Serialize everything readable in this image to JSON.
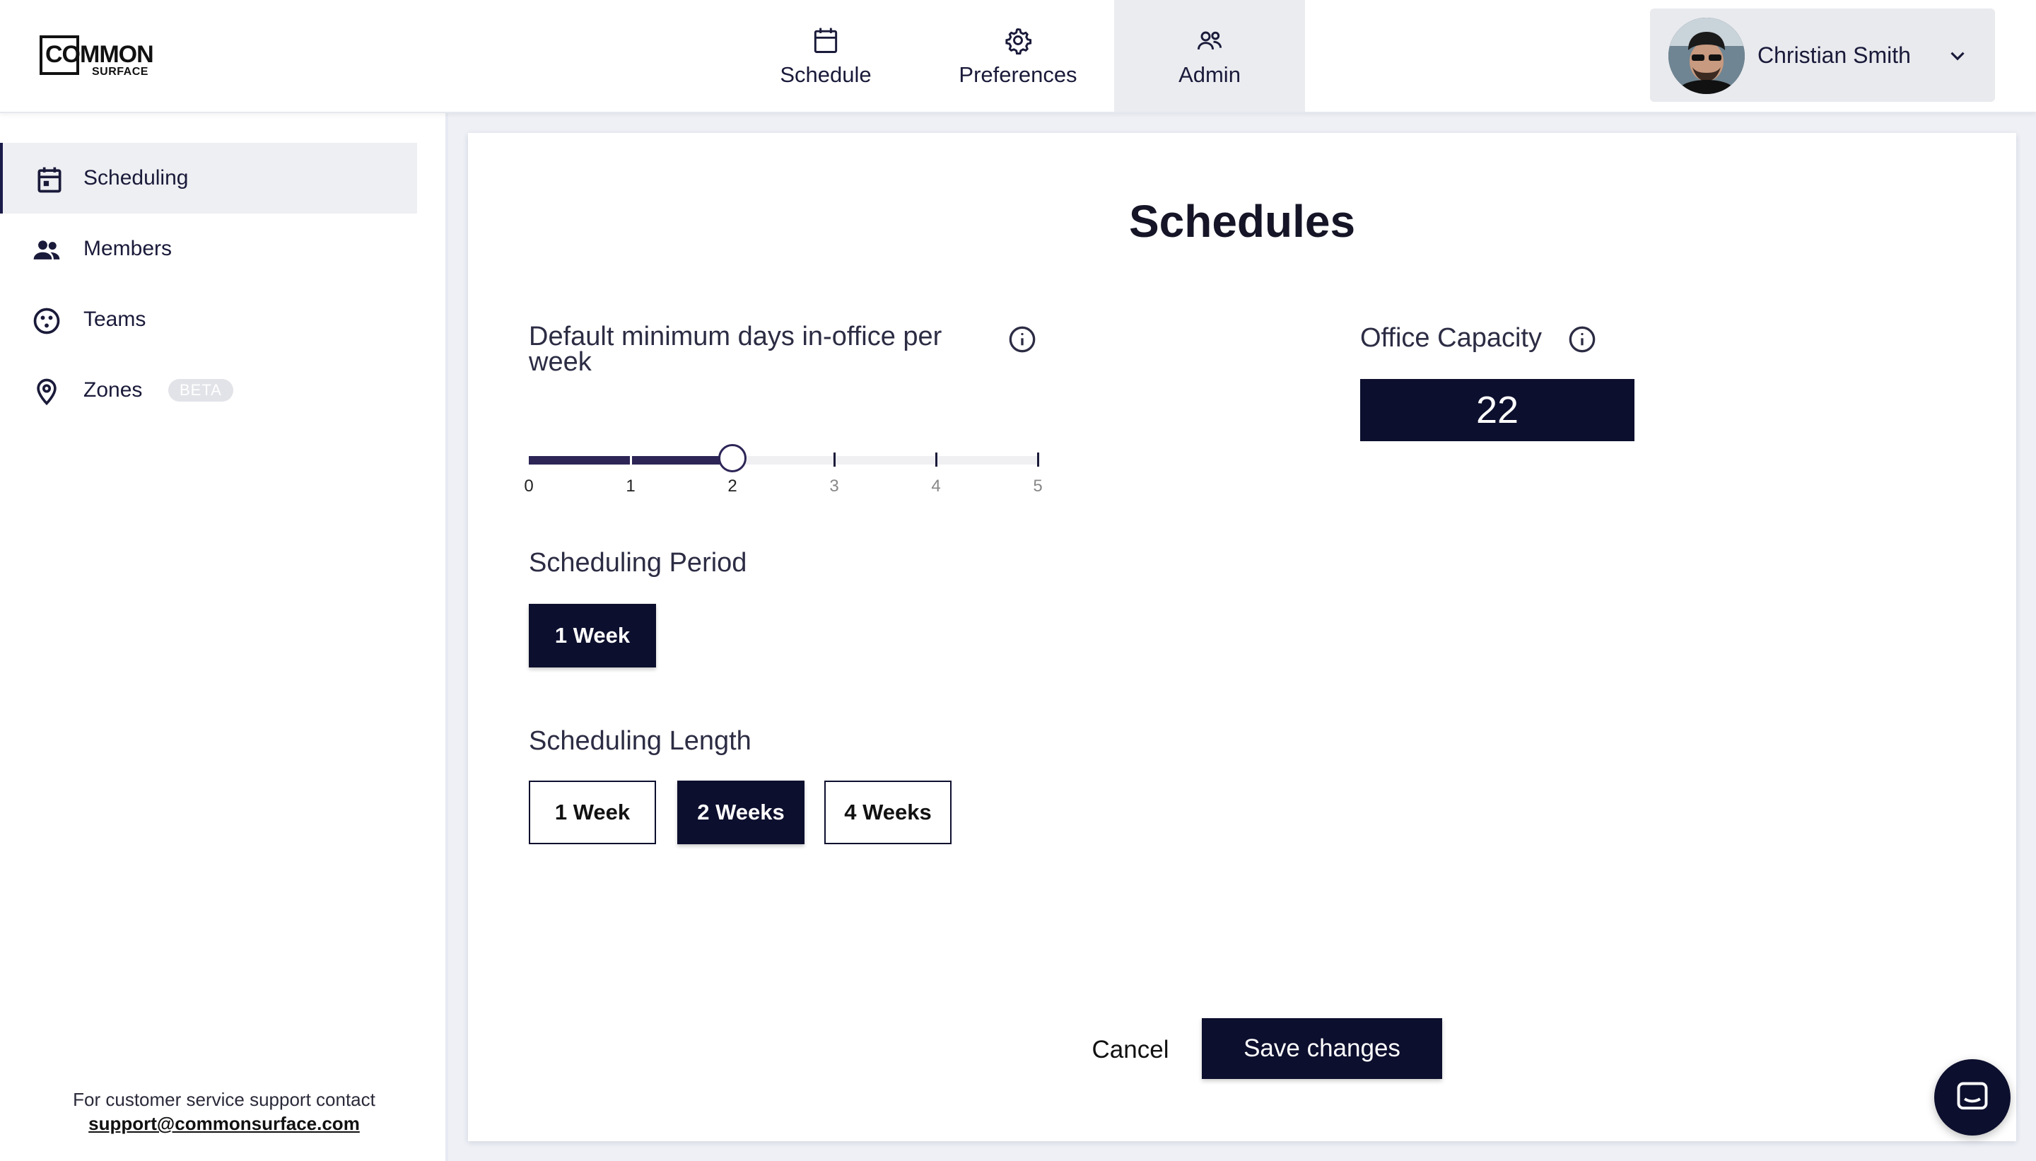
{
  "brand": {
    "logo_line1": "COMMON",
    "logo_line2": "SURFACE"
  },
  "topnav": {
    "tabs": [
      {
        "label": "Schedule",
        "icon": "calendar-icon",
        "active": false
      },
      {
        "label": "Preferences",
        "icon": "gear-icon",
        "active": false
      },
      {
        "label": "Admin",
        "icon": "admin-users-icon",
        "active": true
      }
    ]
  },
  "user": {
    "name": "Christian Smith",
    "menu_icon": "chevron-down-icon"
  },
  "sidebar": {
    "items": [
      {
        "label": "Scheduling",
        "icon": "calendar-icon",
        "active": true
      },
      {
        "label": "Members",
        "icon": "people-icon",
        "active": false
      },
      {
        "label": "Teams",
        "icon": "teams-icon",
        "active": false
      },
      {
        "label": "Zones",
        "icon": "location-pin-icon",
        "active": false,
        "badge": "BETA"
      }
    ],
    "support_text": "For customer service support contact",
    "support_email": "support@commonsurface.com"
  },
  "main": {
    "title": "Schedules",
    "min_days": {
      "label_line1": "Default minimum days in-office per",
      "label_line2": "week",
      "min": 0,
      "max": 5,
      "value": 2,
      "ticks": [
        "0",
        "1",
        "2",
        "3",
        "4",
        "5"
      ]
    },
    "office_capacity": {
      "label": "Office Capacity",
      "value": "22"
    },
    "scheduling_period": {
      "label": "Scheduling Period",
      "options": [
        "1 Week"
      ],
      "selected": "1 Week"
    },
    "scheduling_length": {
      "label": "Scheduling Length",
      "options": [
        "1 Week",
        "2 Weeks",
        "4 Weeks"
      ],
      "selected": "2 Weeks"
    },
    "cancel_label": "Cancel",
    "save_label": "Save changes"
  },
  "colors": {
    "primary": "#0d0f2e",
    "slider_fill": "#2c2556",
    "active_tab_bg": "#ebecf0",
    "page_bg": "#eef0f6"
  }
}
